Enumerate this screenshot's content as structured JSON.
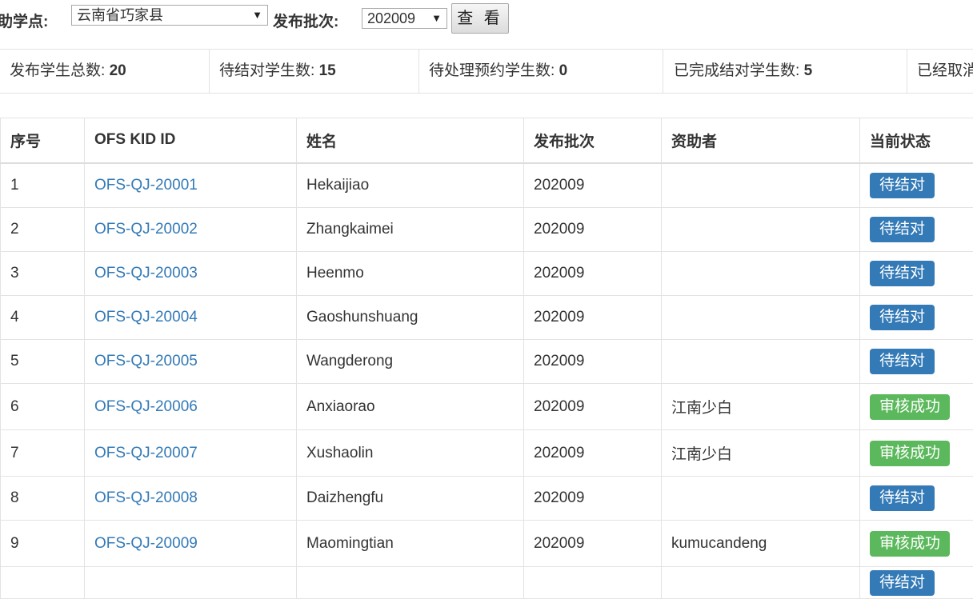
{
  "toolbar": {
    "site_label": "助学点:",
    "site_value": "云南省巧家县",
    "batch_label": "发布批次:",
    "batch_value": "202009",
    "view_button": "查 看"
  },
  "stats": [
    {
      "label": "发布学生总数: ",
      "value": "20"
    },
    {
      "label": "待结对学生数: ",
      "value": "15"
    },
    {
      "label": "待处理预约学生数: ",
      "value": "0"
    },
    {
      "label": "已完成结对学生数: ",
      "value": "5"
    },
    {
      "label": "已经取消",
      "value": ""
    }
  ],
  "table": {
    "headers": [
      "序号",
      "OFS KID ID",
      "姓名",
      "发布批次",
      "资助者",
      "当前状态"
    ],
    "rows": [
      {
        "no": "1",
        "id": "OFS-QJ-20001",
        "name": "Hekaijiao",
        "batch": "202009",
        "sponsor": "",
        "status": "待结对",
        "status_type": "pending"
      },
      {
        "no": "2",
        "id": "OFS-QJ-20002",
        "name": "Zhangkaimei",
        "batch": "202009",
        "sponsor": "",
        "status": "待结对",
        "status_type": "pending"
      },
      {
        "no": "3",
        "id": "OFS-QJ-20003",
        "name": "Heenmo",
        "batch": "202009",
        "sponsor": "",
        "status": "待结对",
        "status_type": "pending"
      },
      {
        "no": "4",
        "id": "OFS-QJ-20004",
        "name": "Gaoshunshuang",
        "batch": "202009",
        "sponsor": "",
        "status": "待结对",
        "status_type": "pending"
      },
      {
        "no": "5",
        "id": "OFS-QJ-20005",
        "name": "Wangderong",
        "batch": "202009",
        "sponsor": "",
        "status": "待结对",
        "status_type": "pending"
      },
      {
        "no": "6",
        "id": "OFS-QJ-20006",
        "name": "Anxiaorao",
        "batch": "202009",
        "sponsor": "江南少白",
        "status": "审核成功",
        "status_type": "success"
      },
      {
        "no": "7",
        "id": "OFS-QJ-20007",
        "name": "Xushaolin",
        "batch": "202009",
        "sponsor": "江南少白",
        "status": "审核成功",
        "status_type": "success"
      },
      {
        "no": "8",
        "id": "OFS-QJ-20008",
        "name": "Daizhengfu",
        "batch": "202009",
        "sponsor": "",
        "status": "待结对",
        "status_type": "pending"
      },
      {
        "no": "9",
        "id": "OFS-QJ-20009",
        "name": "Maomingtian",
        "batch": "202009",
        "sponsor": "kumucandeng",
        "status": "审核成功",
        "status_type": "success"
      },
      {
        "no": "",
        "id": "",
        "name": "",
        "batch": "",
        "sponsor": "",
        "status": "待结对",
        "status_type": "pending"
      }
    ]
  },
  "colors": {
    "link": "#337ab7",
    "pending": "#337ab7",
    "success": "#5cb85c"
  }
}
